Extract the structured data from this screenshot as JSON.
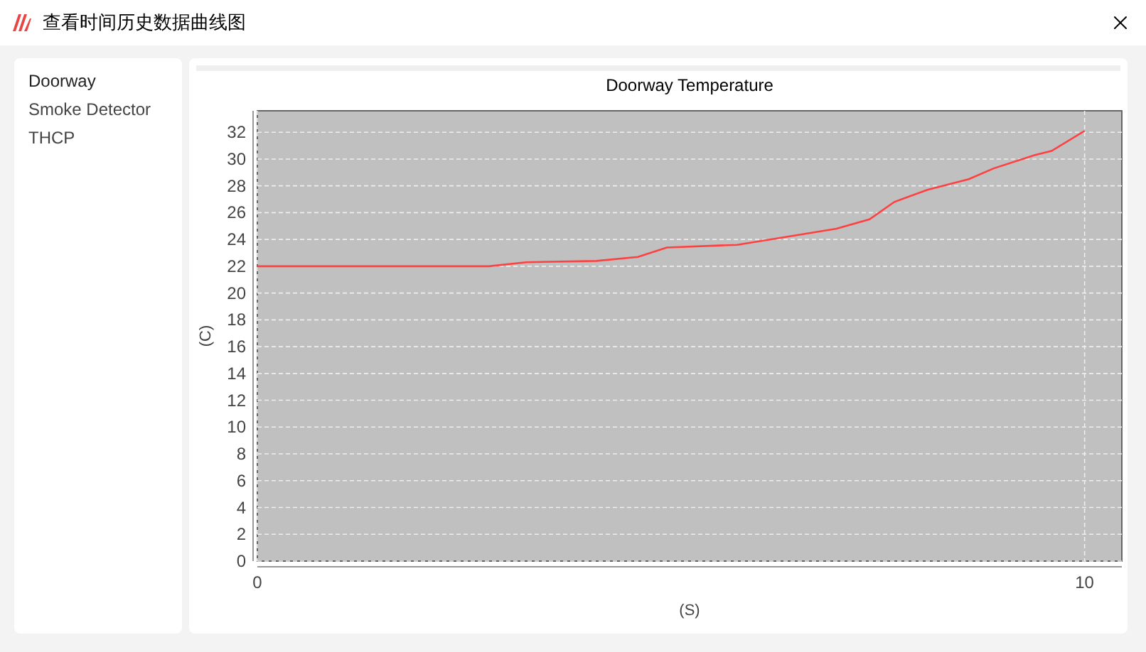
{
  "window": {
    "title": "查看时间历史数据曲线图"
  },
  "sidebar": {
    "items": [
      {
        "label": "Doorway",
        "selected": true
      },
      {
        "label": "Smoke Detector",
        "selected": false
      },
      {
        "label": "THCP",
        "selected": false
      }
    ]
  },
  "chart": {
    "chart_data": {
      "type": "line",
      "title": "Doorway Temperature",
      "xlabel": "(S)",
      "ylabel": "(C)",
      "xlim": [
        0,
        10.45
      ],
      "ylim": [
        0,
        33.6
      ],
      "xticks": [
        0,
        10
      ],
      "yticks": [
        0,
        2,
        4,
        6,
        8,
        10,
        12,
        14,
        16,
        18,
        20,
        22,
        24,
        26,
        28,
        30,
        32
      ],
      "x": [
        0,
        1,
        2,
        2.8,
        3.25,
        4.1,
        4.6,
        4.95,
        5.8,
        6.5,
        7.0,
        7.4,
        7.7,
        8.1,
        8.6,
        8.9,
        9.4,
        9.6,
        10
      ],
      "grid": true,
      "series": [
        {
          "color": "#ff4040",
          "values": [
            22,
            22,
            22,
            22,
            22.3,
            22.4,
            22.7,
            23.4,
            23.6,
            24.3,
            24.8,
            25.5,
            26.8,
            27.7,
            28.5,
            29.3,
            30.3,
            30.6,
            32.1
          ]
        }
      ]
    }
  }
}
